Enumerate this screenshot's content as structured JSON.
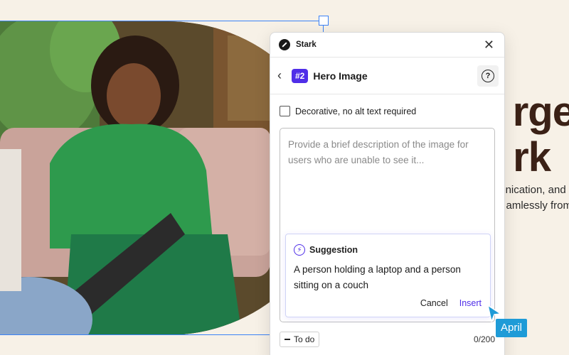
{
  "panel": {
    "app_name": "Stark",
    "item_number": "#2",
    "title": "Hero Image",
    "decorative_label": "Decorative, no alt text required",
    "alt_text_placeholder": "Provide a brief description of the image for users who are unable to see it...",
    "suggestion": {
      "label": "Suggestion",
      "text": "A person holding a laptop and a person sitting on a couch",
      "cancel": "Cancel",
      "insert": "Insert"
    },
    "status_chip": "To do",
    "char_count": "0/200"
  },
  "hero": {
    "line1": "rge",
    "line2": "rk",
    "sub1": "nication, and t",
    "sub2": "amlessly from"
  },
  "collaborator": {
    "name": "April",
    "color": "#1e9bd7"
  },
  "colors": {
    "accent": "#4f2ee8",
    "selection": "#3b82f6"
  },
  "icons": {
    "close": "close-icon",
    "back": "chevron-left-icon",
    "help": "help-icon",
    "suggestion": "lightning-icon",
    "logo": "stark-logo"
  }
}
